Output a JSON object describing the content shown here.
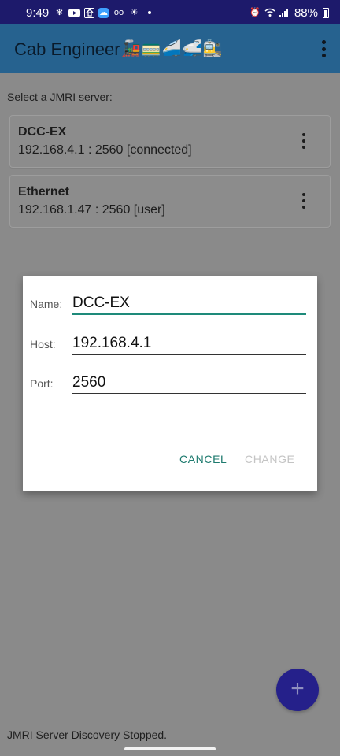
{
  "status_bar": {
    "time": "9:49",
    "battery": "88%",
    "left_icons": [
      "pinwheel-icon",
      "youtube-icon",
      "home-icon",
      "cloud-app-icon",
      "voicemail-icon",
      "weather-icon"
    ],
    "right_icons": [
      "alarm-icon",
      "wifi-icon",
      "signal-icon",
      "battery-icon"
    ]
  },
  "app_bar": {
    "title": "Cab Engineer",
    "title_emoji": "🚂🚃🚄🚅🚉"
  },
  "main": {
    "select_label": "Select a JMRI server:",
    "servers": [
      {
        "name": "DCC-EX",
        "address": "192.168.4.1 : 2560 [connected]"
      },
      {
        "name": "Ethernet",
        "address": "192.168.1.47 : 2560 [user]"
      }
    ],
    "footer_status": "JMRI Server Discovery Stopped.",
    "fab_symbol": "+"
  },
  "dialog": {
    "name_label": "Name:",
    "name_value": "DCC-EX",
    "host_label": "Host:",
    "host_value": "192.168.4.1",
    "port_label": "Port:",
    "port_value": "2560",
    "cancel_label": "CANCEL",
    "change_label": "CHANGE"
  },
  "colors": {
    "status_bar": "#1d1a6b",
    "app_bar": "#26628f",
    "accent": "#1d7a6e",
    "fab": "#25208a",
    "scrim_background": "#8a8a8a"
  }
}
